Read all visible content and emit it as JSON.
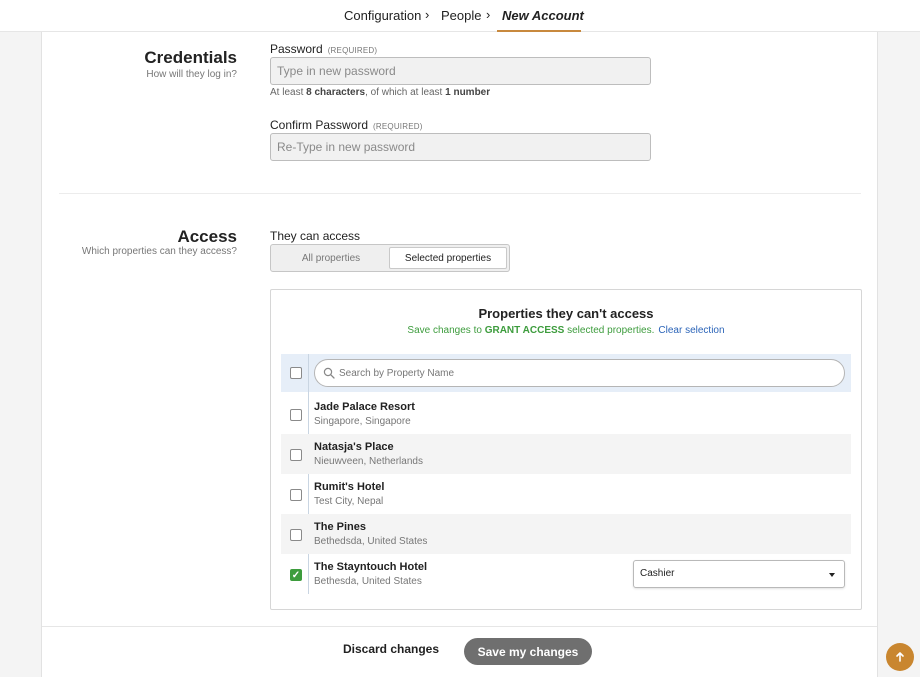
{
  "breadcrumb": {
    "items": [
      "Configuration",
      "People",
      "New Account"
    ],
    "separator": "›"
  },
  "credentials": {
    "title": "Credentials",
    "subtitle": "How will they log in?",
    "password": {
      "label": "Password",
      "required": "(REQUIRED)",
      "placeholder": "Type in new password",
      "value": ""
    },
    "hint": {
      "prefix": "At least ",
      "chars": "8 characters",
      "middle": ", of which at least ",
      "number": "1 number"
    },
    "confirm": {
      "label": "Confirm Password",
      "required": "(REQUIRED)",
      "placeholder": "Re-Type in new password",
      "value": ""
    }
  },
  "access": {
    "title": "Access",
    "subtitle": "Which properties can they access?",
    "label": "They can access",
    "options": [
      "All properties",
      "Selected properties"
    ],
    "selected_option": "Selected properties"
  },
  "properties_panel": {
    "title": "Properties they can't access",
    "note_prefix": "Save changes to ",
    "note_action": "GRANT ACCESS",
    "note_suffix": " selected properties.",
    "clear_label": "Clear selection",
    "search_placeholder": "Search by Property Name",
    "search_value": "",
    "items": [
      {
        "name": "Jade Palace Resort",
        "location": "Singapore, Singapore",
        "checked": false
      },
      {
        "name": "Natasja's Place",
        "location": "Nieuwveen, Netherlands",
        "checked": false
      },
      {
        "name": "Rumit's Hotel",
        "location": "Test City, Nepal",
        "checked": false
      },
      {
        "name": "The Pines",
        "location": "Bethedsda, United States",
        "checked": false
      },
      {
        "name": "The Stayntouch Hotel",
        "location": "Bethesda, United States",
        "checked": true,
        "role": "Cashier"
      }
    ]
  },
  "footer": {
    "discard_label": "Discard changes",
    "save_label": "Save my changes"
  },
  "colors": {
    "accent": "#c8893e",
    "grant_green": "#3d9c3d",
    "link_blue": "#2b64b8",
    "save_button": "#6f6f6f"
  }
}
